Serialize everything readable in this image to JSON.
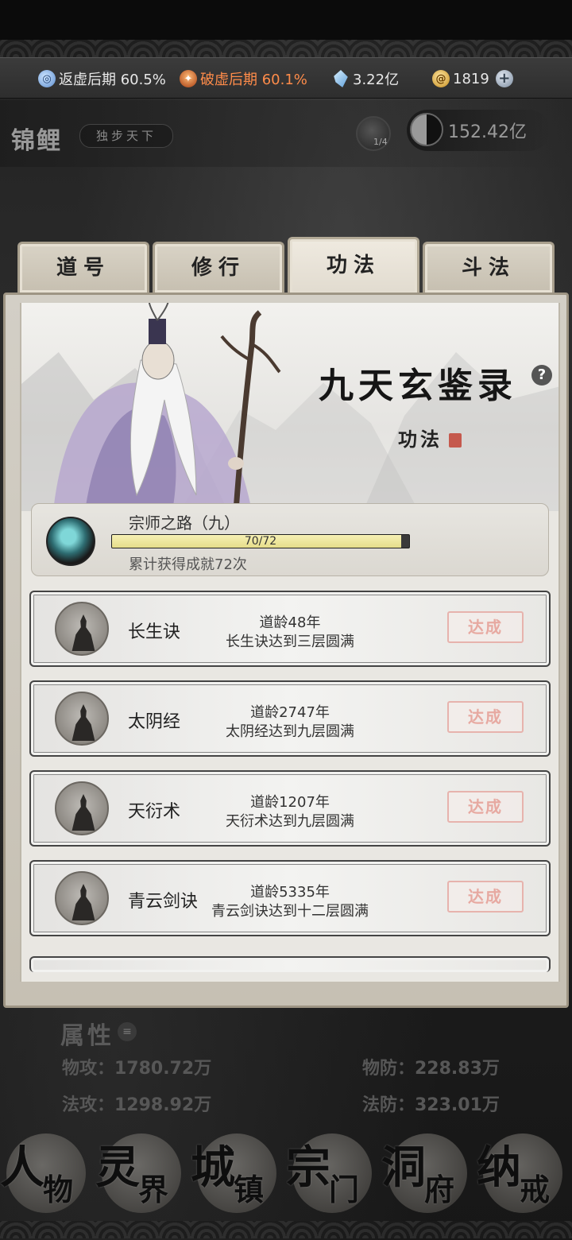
{
  "resources": {
    "realm": "返虚后期 60.5%",
    "breakthrough": "破虚后期 60.1%",
    "spirit_stones": "3.22亿",
    "currency": "1819",
    "add_symbol": "+"
  },
  "player": {
    "name": "锦鲤",
    "title": "独步天下",
    "medal_count": "1/4",
    "power": "152.42亿"
  },
  "tabs": [
    {
      "label": "道号",
      "active": false
    },
    {
      "label": "修行",
      "active": false
    },
    {
      "label": "功法",
      "active": true
    },
    {
      "label": "斗法",
      "active": false
    }
  ],
  "banner": {
    "title": "九天玄鉴录",
    "subtitle": "功法",
    "help_symbol": "?"
  },
  "progress": {
    "name": "宗师之路（九）",
    "current": 70,
    "total": 72,
    "text": "70/72",
    "fraction": 0.972,
    "description": "累计获得成就72次"
  },
  "achievements": [
    {
      "name": "长生诀",
      "line1": "道龄48年",
      "line2": "长生诀达到三层圆满",
      "status": "达成"
    },
    {
      "name": "太阴经",
      "line1": "道龄2747年",
      "line2": "太阴经达到九层圆满",
      "status": "达成"
    },
    {
      "name": "天衍术",
      "line1": "道龄1207年",
      "line2": "天衍术达到九层圆满",
      "status": "达成"
    },
    {
      "name": "青云剑诀",
      "line1": "道龄5335年",
      "line2": "青云剑诀达到十二层圆满",
      "status": "达成"
    }
  ],
  "attributes": {
    "header": "属性",
    "list_icon": "≡",
    "phys_atk": "物攻：1780.72万",
    "phys_def": "物防：228.83万",
    "mag_atk": "法攻：1298.92万",
    "mag_def": "法防：323.01万"
  },
  "nav": [
    {
      "c1": "人",
      "c2": "物"
    },
    {
      "c1": "灵",
      "c2": "界"
    },
    {
      "c1": "城",
      "c2": "镇"
    },
    {
      "c1": "宗",
      "c2": "门"
    },
    {
      "c1": "洞",
      "c2": "府"
    },
    {
      "c1": "纳",
      "c2": "戒"
    }
  ],
  "colors": {
    "progress_fill": "#e6dd8a",
    "done_stamp": "#e7a9a1",
    "breakthrough_text": "#ff8c4a"
  },
  "icons": [
    "realm-orb-icon",
    "breakthrough-icon",
    "spirit-stone-icon",
    "coin-icon",
    "plus-icon",
    "medal-icon",
    "yinyang-icon",
    "help-icon",
    "ring-artifact-icon",
    "cultivator-silhouette-icon",
    "list-icon"
  ]
}
